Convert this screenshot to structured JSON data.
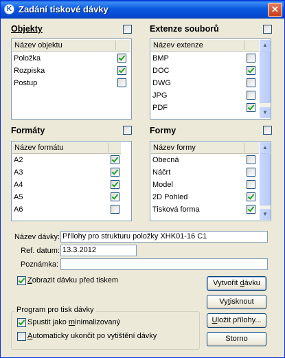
{
  "window": {
    "title": "Zadání tiskové dávky",
    "close_glyph": "✕",
    "app_icon_glyph": "K"
  },
  "objekty": {
    "title": "Objekty",
    "all_checked": false,
    "column": "Název objektu",
    "rows": [
      {
        "label": "Položka",
        "checked": true
      },
      {
        "label": "Rozpiska",
        "checked": true
      },
      {
        "label": "Postup",
        "checked": false
      }
    ]
  },
  "extenze": {
    "title": "Extenze souborů",
    "all_checked": false,
    "column": "Název extenze",
    "rows": [
      {
        "label": "BMP",
        "checked": false
      },
      {
        "label": "DOC",
        "checked": true
      },
      {
        "label": "DWG",
        "checked": false
      },
      {
        "label": "JPG",
        "checked": false
      },
      {
        "label": "PDF",
        "checked": true
      }
    ]
  },
  "formaty": {
    "title": "Formáty",
    "all_checked": false,
    "column": "Název formátu",
    "rows": [
      {
        "label": "A2",
        "checked": true
      },
      {
        "label": "A3",
        "checked": true
      },
      {
        "label": "A4",
        "checked": true
      },
      {
        "label": "A5",
        "checked": true
      },
      {
        "label": "A6",
        "checked": false
      }
    ]
  },
  "formy": {
    "title": "Formy",
    "all_checked": false,
    "column": "Název formy",
    "rows": [
      {
        "label": "Obecná",
        "checked": false
      },
      {
        "label": "Náčrt",
        "checked": false
      },
      {
        "label": "Model",
        "checked": false
      },
      {
        "label": "2D Pohled",
        "checked": true
      },
      {
        "label": "Tisková forma",
        "checked": true
      }
    ]
  },
  "fields": {
    "nazev_label": "Název dávky:",
    "nazev_value": "Přílohy pro strukturu položky XHK01-16 C1",
    "datum_label": "Ref. datum:",
    "datum_value": "13.3.2012",
    "poznamka_label": "Poznámka:",
    "poznamka_value": ""
  },
  "zobrazit": {
    "label_pre": "",
    "label_u": "Z",
    "label_post": "obrazit dávku před tiskem",
    "checked": true
  },
  "program": {
    "title": "Program pro tisk dávky",
    "spustit": {
      "label_pre": "Spustit jako ",
      "label_u": "m",
      "label_post": "inimalizovaný",
      "checked": true
    },
    "ukoncit": {
      "label_pre": "",
      "label_u": "A",
      "label_post": "utomaticky ukončit po vytištění dávky",
      "checked": false
    }
  },
  "buttons": {
    "vytvorit": {
      "pre": "Vytvořit ",
      "u": "d",
      "post": "ávku"
    },
    "vytisknout": {
      "pre": "Vy",
      "u": "t",
      "post": "isknout"
    },
    "ulozit": {
      "pre": "",
      "u": "U",
      "post": "ložit přílohy..."
    },
    "storno": {
      "pre": "",
      "u": "",
      "post": "Storno"
    }
  },
  "colors": {
    "titlebar": "#0a5adf",
    "window_bg": "#ece9d8",
    "check": "#21a121",
    "border": "#7f9db9"
  }
}
